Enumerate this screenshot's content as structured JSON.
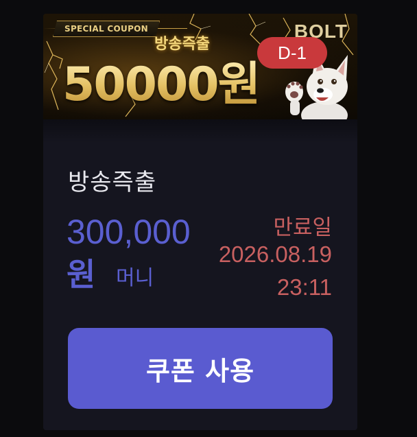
{
  "banner": {
    "tag": "SPECIAL COUPON",
    "subtitle": "방송즉출",
    "amount": "50000원",
    "brand": "BOLT",
    "dday": "D-1",
    "mascot_icon": "dog-mascot",
    "accent_color": "#f1d587"
  },
  "coupon": {
    "title": "방송즉출",
    "amount": "300,000",
    "unit": "원",
    "type": "머니",
    "expiry_label": "만료일",
    "expiry_date": "2026.08.19",
    "expiry_time": "23:11",
    "amount_color": "#5a5fd0",
    "expiry_color": "#c86060"
  },
  "actions": {
    "use_label": "쿠폰 사용",
    "button_color": "#5a5bd0"
  }
}
